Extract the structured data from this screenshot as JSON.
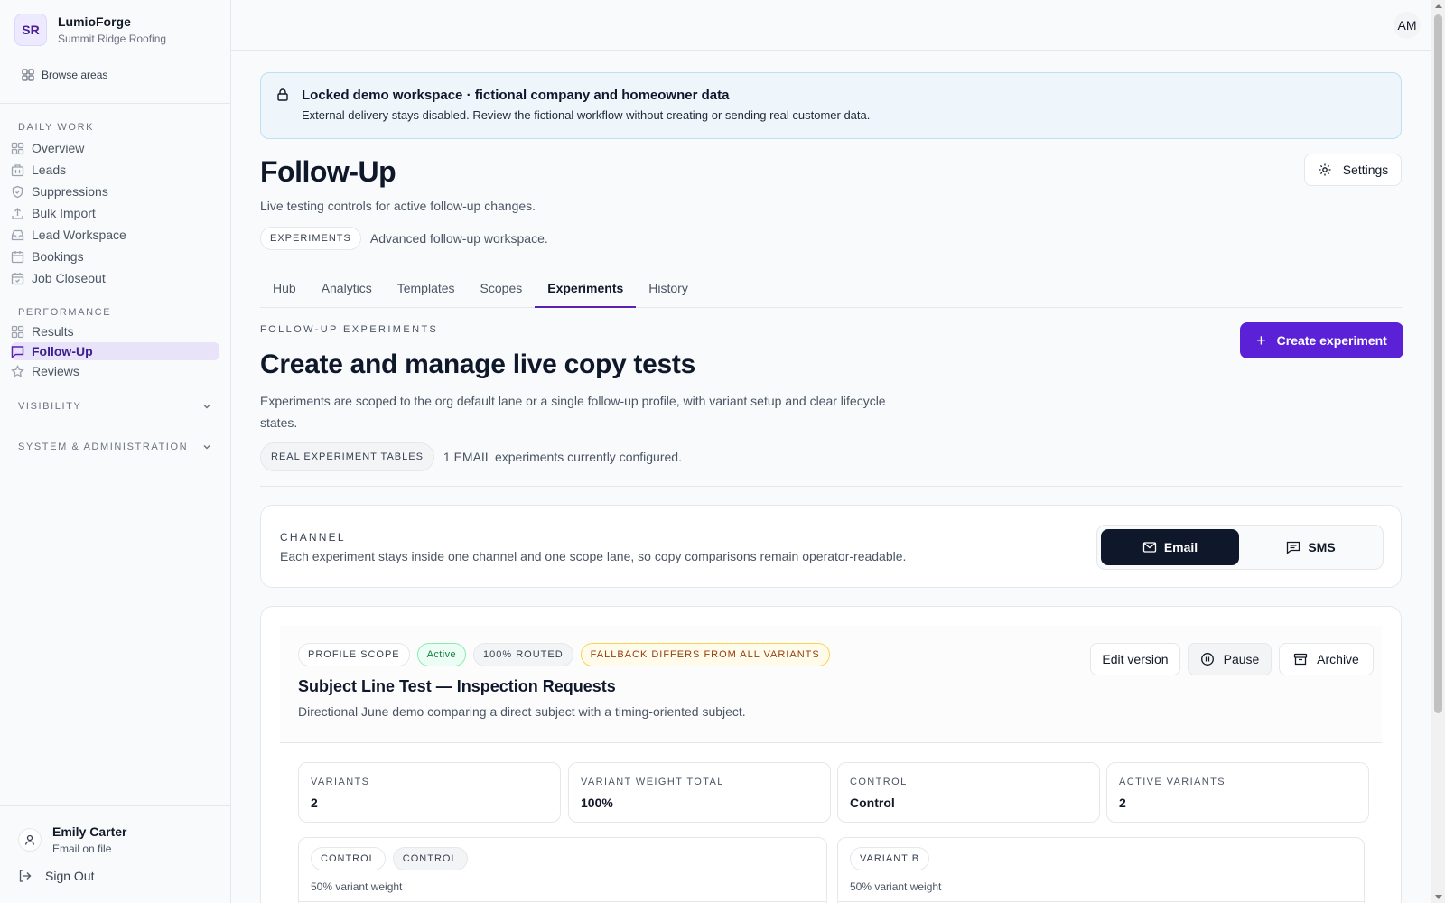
{
  "org": {
    "initials": "SR",
    "name": "LumioForge",
    "company": "Summit Ridge Roofing"
  },
  "sidebar": {
    "browse_label": "Browse areas",
    "daily_work_label": "DAILY WORK",
    "daily_items": [
      {
        "label": "Overview",
        "icon": "grid-icon"
      },
      {
        "label": "Leads",
        "icon": "building-icon"
      },
      {
        "label": "Suppressions",
        "icon": "shield-icon"
      },
      {
        "label": "Bulk Import",
        "icon": "upload-icon"
      },
      {
        "label": "Lead Workspace",
        "icon": "inbox-icon"
      },
      {
        "label": "Bookings",
        "icon": "calendar-icon"
      },
      {
        "label": "Job Closeout",
        "icon": "calendar-check-icon"
      }
    ],
    "performance_label": "PERFORMANCE",
    "performance_items": [
      {
        "label": "Results",
        "icon": "grid-icon"
      },
      {
        "label": "Follow-Up",
        "icon": "message-icon",
        "active": true
      },
      {
        "label": "Reviews",
        "icon": "star-icon"
      }
    ],
    "visibility_label": "VISIBILITY",
    "system_label": "SYSTEM & ADMINISTRATION"
  },
  "user": {
    "name": "Emily Carter",
    "subtitle": "Email on file",
    "signout_label": "Sign Out",
    "initials": "AM"
  },
  "banner": {
    "title": "Locked demo workspace · fictional company and homeowner data",
    "body": "External delivery stays disabled. Review the fictional workflow without creating or sending real customer data."
  },
  "page": {
    "title": "Follow-Up",
    "subtitle": "Live testing controls for active follow-up changes.",
    "settings_label": "Settings",
    "pill_label": "EXPERIMENTS",
    "pill_desc": "Advanced follow-up workspace."
  },
  "tabs": [
    "Hub",
    "Analytics",
    "Templates",
    "Scopes",
    "Experiments",
    "History"
  ],
  "active_tab": "Experiments",
  "section": {
    "kicker": "FOLLOW-UP EXPERIMENTS",
    "title": "Create and manage live copy tests",
    "desc": "Experiments are scoped to the org default lane or a single follow-up profile, with variant setup and clear lifecycle states.",
    "create_label": "Create experiment",
    "real_pill": "REAL EXPERIMENT TABLES",
    "real_desc": "1 EMAIL experiments currently configured."
  },
  "channel": {
    "label": "CHANNEL",
    "desc": "Each experiment stays inside one channel and one scope lane, so copy comparisons remain operator-readable.",
    "options": [
      "Email",
      "SMS"
    ],
    "selected": "Email"
  },
  "experiment": {
    "badges": [
      "PROFILE SCOPE",
      "Active",
      "100% ROUTED",
      "FALLBACK DIFFERS FROM ALL VARIANTS"
    ],
    "title": "Subject Line Test — Inspection Requests",
    "desc": "Directional June demo comparing a direct subject with a timing-oriented subject.",
    "actions": {
      "edit": "Edit version",
      "pause": "Pause",
      "archive": "Archive"
    },
    "stats": [
      {
        "label": "VARIANTS",
        "value": "2"
      },
      {
        "label": "VARIANT WEIGHT TOTAL",
        "value": "100%"
      },
      {
        "label": "CONTROL",
        "value": "Control"
      },
      {
        "label": "ACTIVE VARIANTS",
        "value": "2"
      }
    ],
    "variants": [
      {
        "badges": [
          "CONTROL",
          "CONTROL"
        ],
        "weight": "50% variant weight"
      },
      {
        "badges": [
          "VARIANT B"
        ],
        "weight": "50% variant weight"
      }
    ]
  },
  "colors": {
    "accent": "#5b21d6",
    "active_nav_bg": "#e8e3f8",
    "dark_button": "#0f172a",
    "banner_bg": "#eef6fc"
  }
}
